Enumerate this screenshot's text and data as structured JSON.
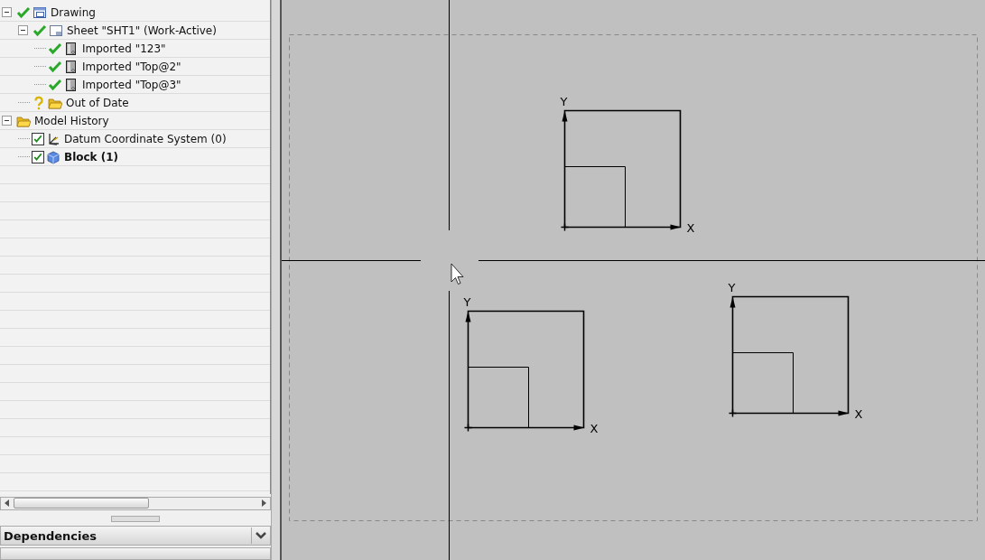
{
  "tree": [
    {
      "label": "Drawing",
      "up_to_date": true,
      "kind": "drawing",
      "expanded": true,
      "children": [
        {
          "label": "Sheet \"SHT1\" (Work-Active)",
          "up_to_date": true,
          "kind": "sheet",
          "expanded": true,
          "children": [
            {
              "label": "Imported \"123\"",
              "up_to_date": true,
              "kind": "view"
            },
            {
              "label": "Imported \"Top@2\"",
              "up_to_date": true,
              "kind": "view"
            },
            {
              "label": "Imported \"Top@3\"",
              "up_to_date": true,
              "kind": "view"
            }
          ]
        },
        {
          "label": "Out of Date",
          "up_to_date": false,
          "kind": "folder"
        }
      ]
    },
    {
      "label": "Model History",
      "kind": "folder",
      "expanded": true,
      "children": [
        {
          "label": "Datum Coordinate System (0)",
          "checked": true,
          "kind": "datum"
        },
        {
          "label": "Block (1)",
          "checked": true,
          "kind": "block",
          "bold": true
        }
      ]
    }
  ],
  "panels": [
    {
      "title": "Dependencies",
      "expanded": false
    }
  ],
  "views": [
    {
      "x_label": "X",
      "y_label": "Y"
    },
    {
      "x_label": "X",
      "y_label": "Y"
    },
    {
      "x_label": "X",
      "y_label": "Y"
    }
  ]
}
